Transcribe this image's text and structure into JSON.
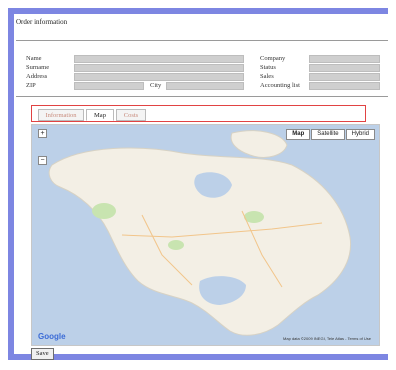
{
  "header": {
    "title": "Order information"
  },
  "form": {
    "left_labels": [
      "Name",
      "Surname",
      "Address",
      "ZIP"
    ],
    "city_label": "City",
    "right_labels": [
      "Company",
      "Status",
      "Sales",
      "Accounting list"
    ]
  },
  "tabs": [
    {
      "label": "Information",
      "active": false
    },
    {
      "label": "Map",
      "active": true
    },
    {
      "label": "Costs",
      "active": false
    }
  ],
  "map": {
    "types": [
      "Map",
      "Satellite",
      "Hybrid"
    ],
    "selected_type": "Map",
    "logo": "Google",
    "copyright": "Map data ©2009 INEGI, Tele Atlas - Terms of Use",
    "colors": {
      "water": "#bcd0e8",
      "land": "#f3efe5",
      "parks": "#c8e4b0"
    }
  },
  "footer": {
    "save_label": "Save"
  },
  "colors": {
    "accent_frame": "#7d86e2",
    "tab_outline": "#e14343"
  }
}
